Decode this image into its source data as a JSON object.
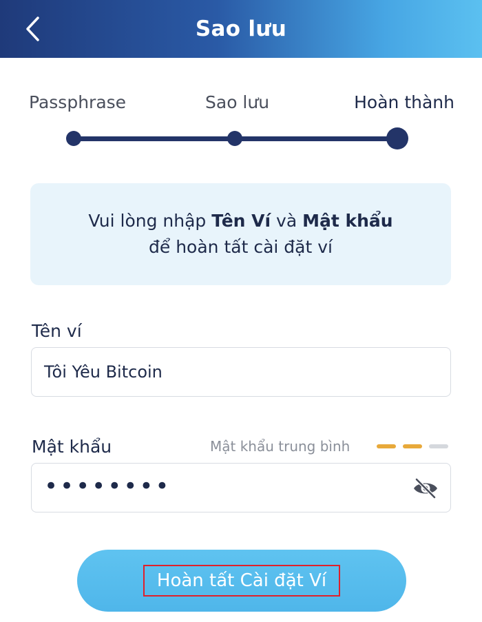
{
  "header": {
    "title": "Sao lưu",
    "back_icon": "chevron-left-icon"
  },
  "stepper": {
    "steps": [
      {
        "label": "Passphrase",
        "state": "done"
      },
      {
        "label": "Sao lưu",
        "state": "done"
      },
      {
        "label": "Hoàn thành",
        "state": "current"
      }
    ],
    "color": "#233468"
  },
  "info": {
    "line1_prefix": "Vui lòng nhập ",
    "line1_name": "Tên Ví",
    "line1_mid": " và ",
    "line1_pass": "Mật khẩu",
    "line2": "để hoàn tất cài đặt ví"
  },
  "form": {
    "name_label": "Tên ví",
    "name_value": "Tôi Yêu Bitcoin",
    "password_label": "Mật khẩu",
    "password_mask": "••••••••",
    "strength_text": "Mật khẩu trung bình",
    "strength_level": 2,
    "strength_max": 3,
    "strength_colors": {
      "active": "#e8a93a",
      "inactive": "#d5d8dd"
    },
    "eye_icon": "eye-off-icon"
  },
  "actions": {
    "submit_label": "Hoàn tất Cài đặt Ví"
  }
}
